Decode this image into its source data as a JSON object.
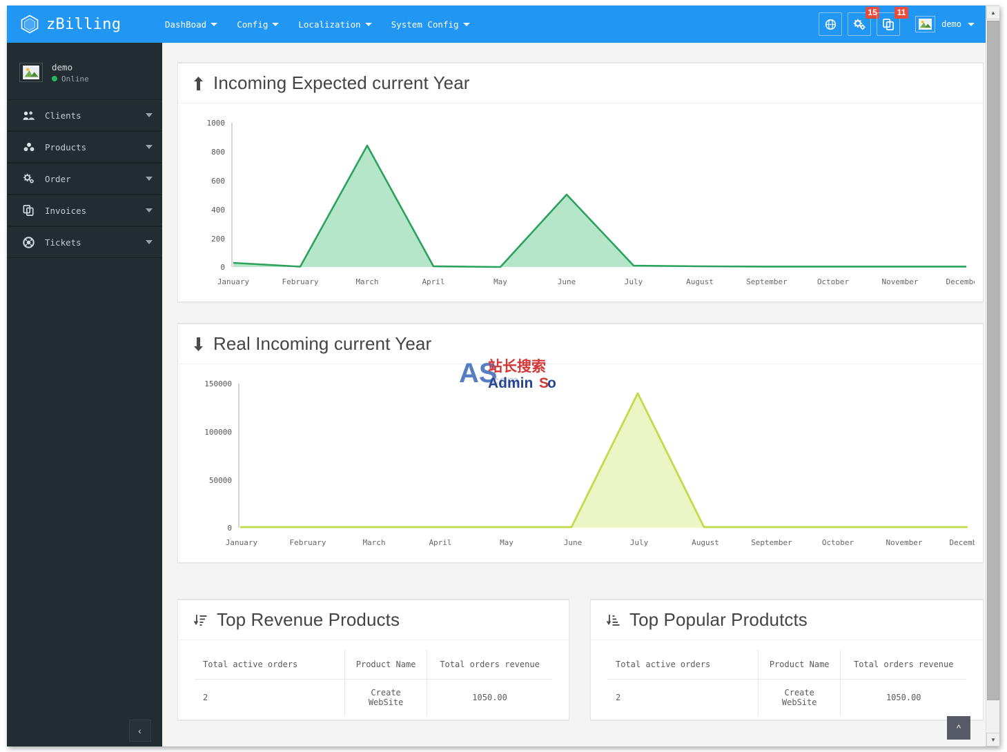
{
  "app": {
    "brand": "zBilling",
    "brand_icon": "hexagon-icon"
  },
  "navbar": {
    "menu": [
      {
        "label": "DashBoad",
        "has_caret": true
      },
      {
        "label": "Config",
        "has_caret": true
      },
      {
        "label": "Localization",
        "has_caret": true
      },
      {
        "label": "System Config",
        "has_caret": true
      }
    ],
    "actions": [
      {
        "icon": "globe-icon",
        "badge": ""
      },
      {
        "icon": "gears-icon",
        "badge": "15"
      },
      {
        "icon": "copy-icon",
        "badge": "11"
      }
    ],
    "user": {
      "name": "demo",
      "avatar_icon": "image-icon",
      "caret": true
    }
  },
  "sidebar": {
    "user": {
      "name": "demo",
      "status": "Online",
      "avatar_icon": "image-icon",
      "status_color": "#28b463"
    },
    "items": [
      {
        "label": "Clients",
        "icon": "users-icon"
      },
      {
        "label": "Products",
        "icon": "cubes-icon"
      },
      {
        "label": "Order",
        "icon": "gears-icon"
      },
      {
        "label": "Invoices",
        "icon": "copy-icon"
      },
      {
        "label": "Tickets",
        "icon": "lifebuoy-icon"
      }
    ],
    "collapse_icon": "chevron-left-icon"
  },
  "panels": {
    "incoming_expected": {
      "title": "Incoming Expected current Year",
      "icon": "arrow-up-icon"
    },
    "real_incoming": {
      "title": "Real Incoming current Year",
      "icon": "arrow-down-icon"
    },
    "top_revenue": {
      "title": "Top Revenue Products",
      "icon": "sort-amount-desc-icon"
    },
    "top_popular": {
      "title": "Top Popular Produtcts",
      "icon": "sort-amount-asc-icon"
    }
  },
  "tables": {
    "top_revenue": {
      "columns": [
        "Total active orders",
        "Product Name",
        "Total orders revenue"
      ],
      "rows": [
        [
          "2",
          "Create WebSite",
          "1050.00"
        ]
      ]
    },
    "top_popular": {
      "columns": [
        "Total active orders",
        "Product Name",
        "Total orders revenue"
      ],
      "rows": [
        [
          "2",
          "Create WebSite",
          "1050.00"
        ]
      ]
    }
  },
  "watermark": {
    "logo": "AS",
    "chinese": "站长搜索",
    "latin": "AdminSo",
    "faint": ".com"
  },
  "scroll_top_icon": "chevron-up-icon",
  "chart_data": [
    {
      "type": "area",
      "title": "Incoming Expected current Year",
      "categories": [
        "January",
        "February",
        "March",
        "April",
        "May",
        "June",
        "July",
        "August",
        "September",
        "October",
        "November",
        "December"
      ],
      "values": [
        30,
        2,
        840,
        5,
        0,
        500,
        10,
        5,
        3,
        3,
        3,
        3
      ],
      "xlabel": "",
      "ylabel": "",
      "ylim": [
        0,
        1000
      ],
      "yticks": [
        0,
        200,
        400,
        600,
        800,
        1000
      ],
      "line_color": "#2aa25b",
      "fill_color": "#a9e2c1",
      "grid": false,
      "legend": "none"
    },
    {
      "type": "area",
      "title": "Real Incoming current Year",
      "categories": [
        "January",
        "February",
        "March",
        "April",
        "May",
        "June",
        "July",
        "August",
        "September",
        "October",
        "November",
        "December"
      ],
      "values": [
        0,
        0,
        0,
        0,
        0,
        0,
        140000,
        0,
        0,
        0,
        0,
        0
      ],
      "xlabel": "",
      "ylabel": "",
      "ylim": [
        0,
        150000
      ],
      "yticks": [
        0,
        50000,
        100000,
        150000
      ],
      "line_color": "#c0dc48",
      "fill_color": "#eaf5bf",
      "grid": false,
      "legend": "none"
    }
  ]
}
